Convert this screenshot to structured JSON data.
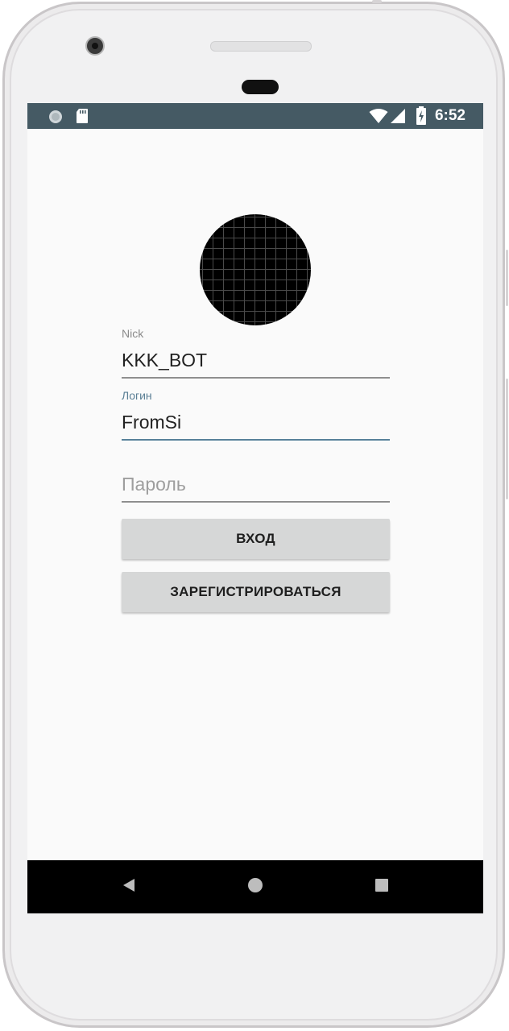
{
  "status_bar": {
    "time": "6:52",
    "left_icons": [
      "circle-notification-icon",
      "sd-card-icon"
    ],
    "right_icons": [
      "wifi-icon",
      "signal-icon",
      "battery-charging-icon"
    ],
    "background_color": "#455a64"
  },
  "profile": {
    "avatar": "avatar-grid-image"
  },
  "form": {
    "nick": {
      "label": "Nick",
      "value": "KKK_BOT"
    },
    "login": {
      "label": "Логин",
      "value": "FromSi",
      "focused": true
    },
    "password": {
      "placeholder": "Пароль",
      "value": ""
    }
  },
  "buttons": {
    "login_label": "ВХОД",
    "register_label": "ЗАРЕГИСТРИРОВАТЬСЯ"
  },
  "navbar": {
    "icons": [
      "back-icon",
      "home-icon",
      "recents-icon"
    ]
  },
  "colors": {
    "accent": "#58819a",
    "screen_background": "#fafafa",
    "button_background": "#d6d7d7"
  }
}
